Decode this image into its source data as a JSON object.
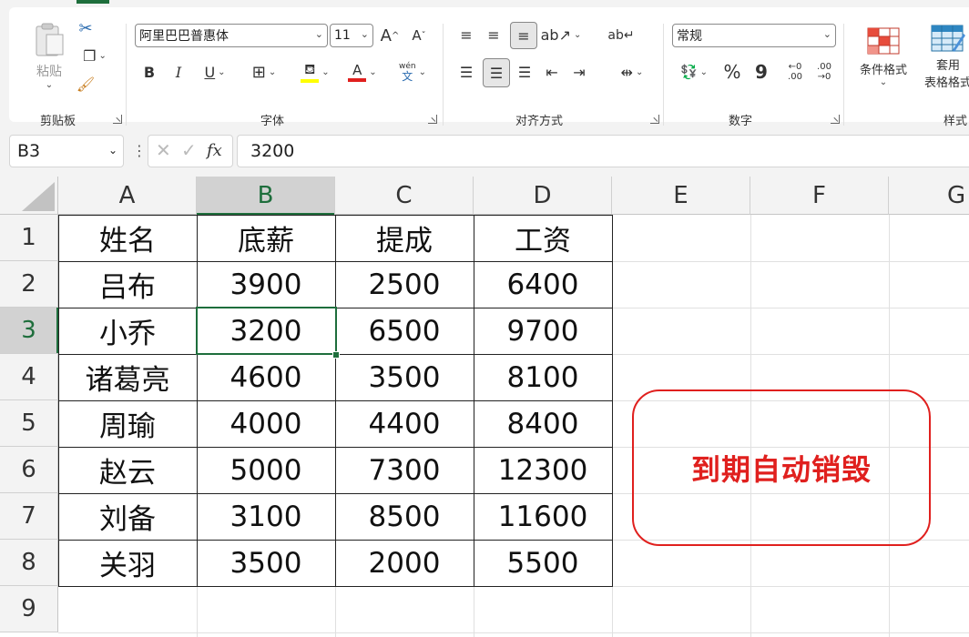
{
  "ribbon": {
    "clipboard": {
      "paste_label": "粘贴",
      "group_label": "剪贴板"
    },
    "font": {
      "font_name": "阿里巴巴普惠体",
      "font_size": "11",
      "group_label": "字体",
      "bold": "B",
      "italic": "I",
      "underline": "U",
      "phonetic_top": "wén",
      "phonetic_bottom": "文",
      "font_color": "A",
      "grow": "A",
      "shrink": "A"
    },
    "alignment": {
      "group_label": "对齐方式"
    },
    "number": {
      "format": "常规",
      "group_label": "数字",
      "percent": "%",
      "comma": "9",
      "inc_decimal_top": "←0",
      "inc_decimal_bottom": ".00",
      "dec_decimal_top": ".00",
      "dec_decimal_bottom": "→0"
    },
    "styles": {
      "conditional_format": "条件格式",
      "table_format_top": "套用",
      "table_format_bottom": "表格格式",
      "group_label": "样式"
    }
  },
  "formula_bar": {
    "name_box": "B3",
    "fx": "fx",
    "value": "3200"
  },
  "columns": [
    "A",
    "B",
    "C",
    "D",
    "E",
    "F",
    "G"
  ],
  "rows": [
    "1",
    "2",
    "3",
    "4",
    "5",
    "6",
    "7",
    "8",
    "9"
  ],
  "table": [
    [
      "姓名",
      "底薪",
      "提成",
      "工资"
    ],
    [
      "吕布",
      "3900",
      "2500",
      "6400"
    ],
    [
      "小乔",
      "3200",
      "6500",
      "9700"
    ],
    [
      "诸葛亮",
      "4600",
      "3500",
      "8100"
    ],
    [
      "周瑜",
      "4000",
      "4400",
      "8400"
    ],
    [
      "赵云",
      "5000",
      "7300",
      "12300"
    ],
    [
      "刘备",
      "3100",
      "8500",
      "11600"
    ],
    [
      "关羽",
      "3500",
      "2000",
      "5500"
    ]
  ],
  "active_cell": "B3",
  "callout_text": "到期自动销毁",
  "colors": {
    "accent": "#1e6e3c",
    "callout": "#e0201e"
  }
}
